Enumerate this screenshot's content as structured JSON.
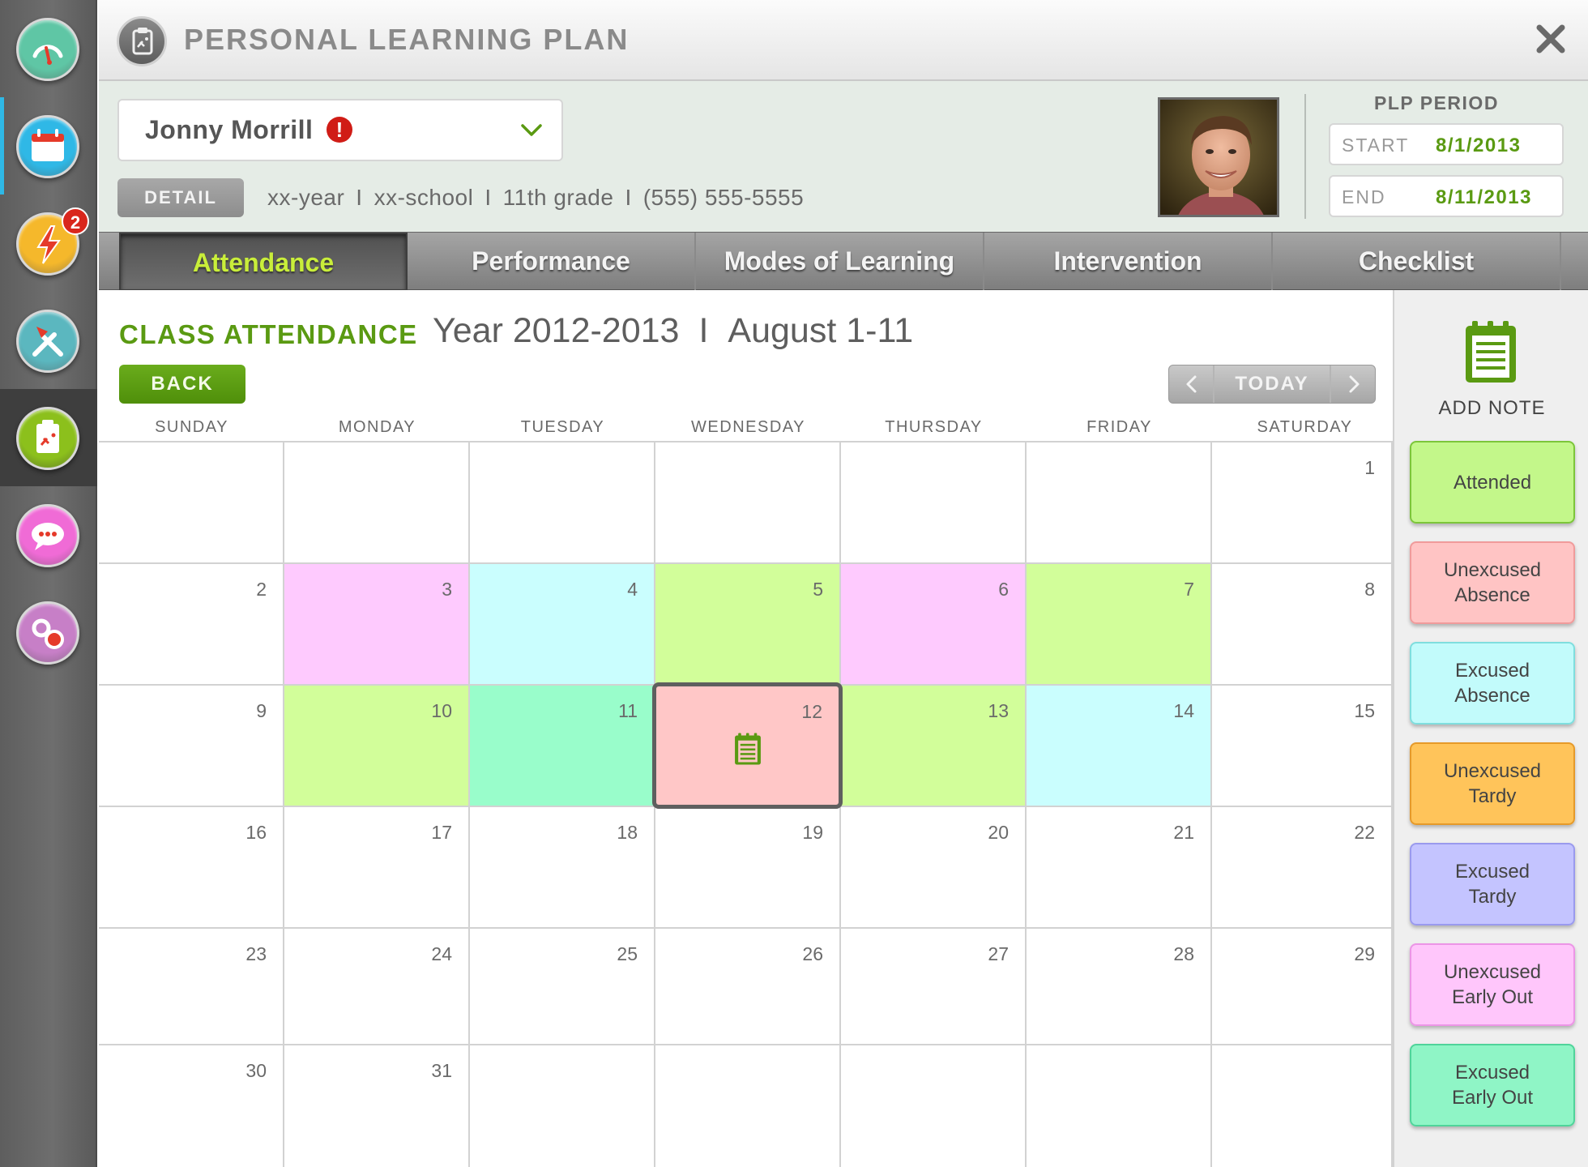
{
  "header": {
    "title": "PERSONAL LEARNING PLAN"
  },
  "rail": [
    {
      "name": "dashboard-gauge-icon",
      "color": "#5fc6a5",
      "badge": ""
    },
    {
      "name": "calendar-icon",
      "color": "#2fb8e6",
      "badge": ""
    },
    {
      "name": "alerts-lightning-icon",
      "color": "#f5b82b",
      "badge": "2"
    },
    {
      "name": "tools-icon",
      "color": "#5bb7bf",
      "badge": ""
    },
    {
      "name": "plan-clipboard-icon",
      "color": "#8cc01c",
      "badge": ""
    },
    {
      "name": "chat-icon",
      "color": "#f06bd6",
      "badge": ""
    },
    {
      "name": "settings-gears-icon",
      "color": "#c77fc7",
      "badge": ""
    }
  ],
  "student": {
    "name": "Jonny Morrill",
    "alert": "!",
    "detail_label": "DETAIL",
    "year": "xx-year",
    "school": "xx-school",
    "grade": "11th grade",
    "phone": "(555) 555-5555",
    "sep": "I"
  },
  "plp_period": {
    "label": "PLP PERIOD",
    "start_label": "START",
    "start_value": "8/1/2013",
    "end_label": "END",
    "end_value": "8/11/2013"
  },
  "tabs": [
    {
      "label": "Attendance",
      "active": true
    },
    {
      "label": "Performance",
      "active": false
    },
    {
      "label": "Modes of Learning",
      "active": false
    },
    {
      "label": "Intervention",
      "active": false
    },
    {
      "label": "Checklist",
      "active": false
    }
  ],
  "calendar": {
    "section_title": "CLASS ATTENDANCE",
    "year_text": "Year 2012-2013",
    "sep": "I",
    "range_text": "August 1-11",
    "back_label": "BACK",
    "today_label": "TODAY",
    "weekdays": [
      "SUNDAY",
      "MONDAY",
      "TUESDAY",
      "WEDNESDAY",
      "THURSDAY",
      "FRIDAY",
      "SATURDAY"
    ],
    "weeks": [
      [
        {
          "day": ""
        },
        {
          "day": ""
        },
        {
          "day": ""
        },
        {
          "day": ""
        },
        {
          "day": ""
        },
        {
          "day": ""
        },
        {
          "day": "1"
        }
      ],
      [
        {
          "day": "2"
        },
        {
          "day": "3",
          "status": "unexcused_early_out"
        },
        {
          "day": "4",
          "status": "excused_absence"
        },
        {
          "day": "5",
          "status": "attended"
        },
        {
          "day": "6",
          "status": "unexcused_early_out"
        },
        {
          "day": "7",
          "status": "attended"
        },
        {
          "day": "8"
        }
      ],
      [
        {
          "day": "9"
        },
        {
          "day": "10",
          "status": "attended"
        },
        {
          "day": "11",
          "status": "excused_early_out"
        },
        {
          "day": "12",
          "status": "unexcused_absence",
          "selected": true,
          "note": true
        },
        {
          "day": "13",
          "status": "attended"
        },
        {
          "day": "14",
          "status": "excused_absence"
        },
        {
          "day": "15"
        }
      ],
      [
        {
          "day": "16"
        },
        {
          "day": "17"
        },
        {
          "day": "18"
        },
        {
          "day": "19"
        },
        {
          "day": "20"
        },
        {
          "day": "21"
        },
        {
          "day": "22"
        }
      ],
      [
        {
          "day": "23"
        },
        {
          "day": "24"
        },
        {
          "day": "25"
        },
        {
          "day": "26"
        },
        {
          "day": "27"
        },
        {
          "day": "28"
        },
        {
          "day": "29"
        }
      ],
      [
        {
          "day": "30"
        },
        {
          "day": "31"
        },
        {
          "day": ""
        },
        {
          "day": ""
        },
        {
          "day": ""
        },
        {
          "day": ""
        },
        {
          "day": ""
        }
      ]
    ]
  },
  "legend": {
    "add_note_label": "ADD NOTE",
    "items": [
      {
        "key": "attended",
        "label": "Attended",
        "color": "#c3f78a",
        "border": "#7cc63a"
      },
      {
        "key": "unexcused_absence",
        "label": "Unexcused\nAbsence",
        "color": "#ffc4c4",
        "border": "#f09b9b"
      },
      {
        "key": "excused_absence",
        "label": "Excused\nAbsence",
        "color": "#c2fbfb",
        "border": "#7fdede"
      },
      {
        "key": "unexcused_tardy",
        "label": "Unexcused\nTardy",
        "color": "#ffc45a",
        "border": "#e69a2a"
      },
      {
        "key": "excused_tardy",
        "label": "Excused\nTardy",
        "color": "#c4c4ff",
        "border": "#9a9aee"
      },
      {
        "key": "unexcused_early_out",
        "label": "Unexcused\nEarly Out",
        "color": "#ffc6fb",
        "border": "#ec95e6"
      },
      {
        "key": "excused_early_out",
        "label": "Excused\nEarly Out",
        "color": "#8ff5c6",
        "border": "#4fd49a"
      }
    ]
  },
  "status_colors": {
    "attended": "#d2fe9a",
    "unexcused_absence": "#ffc7c7",
    "excused_absence": "#cafefe",
    "unexcused_tardy": "#ffca66",
    "excused_tardy": "#cacafe",
    "unexcused_early_out": "#fecafe",
    "excused_early_out": "#99fdcb"
  },
  "accent_green": "#5a9a12",
  "tab_active_text": "#c9ee3a"
}
